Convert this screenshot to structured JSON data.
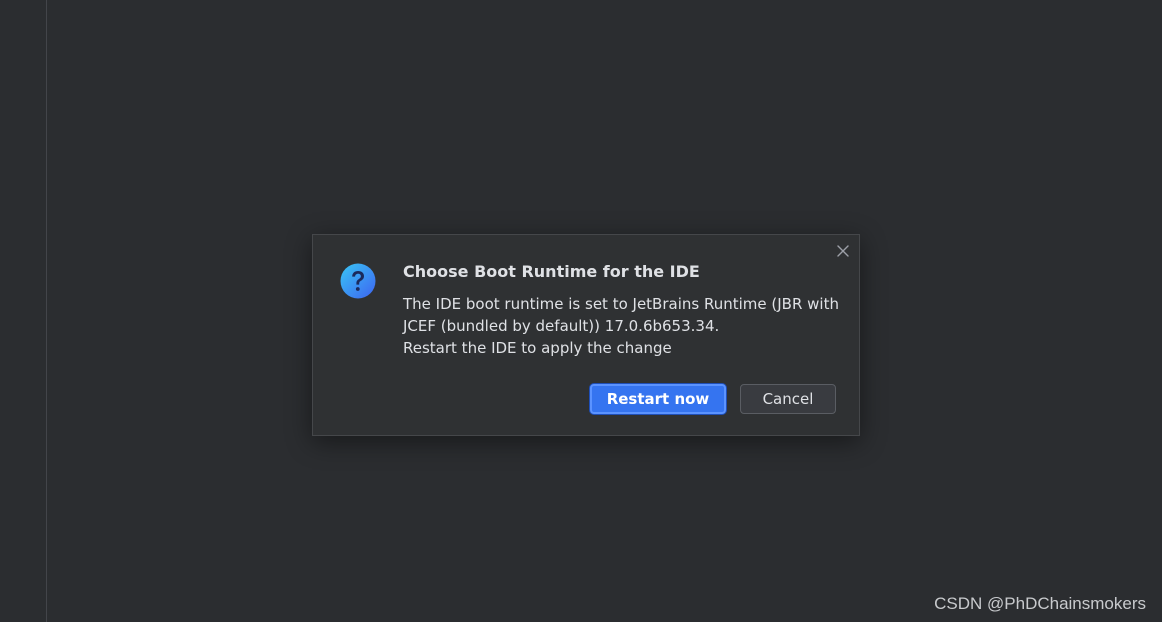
{
  "dialog": {
    "title": "Choose Boot Runtime for the IDE",
    "message_lines": [
      "The IDE boot runtime is set to JetBrains Runtime (JBR with",
      "JCEF (bundled by default)) 17.0.6b653.34.",
      "Restart the IDE to apply the change"
    ],
    "primary_button": "Restart now",
    "secondary_button": "Cancel",
    "icon": "question-icon",
    "close_icon": "close-icon"
  },
  "colors": {
    "background": "#2b2d30",
    "dialog_bg": "#2f3133",
    "primary": "#3574f0",
    "text": "#dfe1e5"
  },
  "watermark": "CSDN @PhDChainsmokers"
}
